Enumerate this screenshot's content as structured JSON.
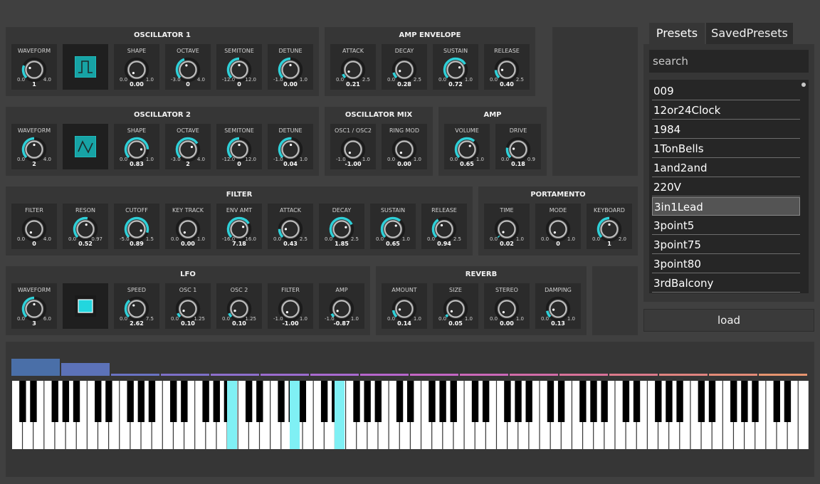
{
  "oscillator1": {
    "title": "OSCILLATOR 1",
    "waveform_icon": "square-wave-icon",
    "knobs": [
      {
        "label": "WAVEFORM",
        "min": "0.0",
        "max": "4.0",
        "value": "1",
        "frac": 0.25
      },
      {
        "label": "SHAPE",
        "min": "0.0",
        "max": "1.0",
        "value": "0.00",
        "frac": 0.0
      },
      {
        "label": "OCTAVE",
        "min": "-3.0",
        "max": "4.0",
        "value": "0",
        "frac": 0.43
      },
      {
        "label": "SEMITONE",
        "min": "-12.0",
        "max": "12.0",
        "value": "0",
        "frac": 0.5
      },
      {
        "label": "DETUNE",
        "min": "-1.0",
        "max": "1.0",
        "value": "0.00",
        "frac": 0.5
      }
    ]
  },
  "amp_envelope": {
    "title": "AMP ENVELOPE",
    "knobs": [
      {
        "label": "ATTACK",
        "min": "0.0",
        "max": "2.5",
        "value": "0.21",
        "frac": 0.08
      },
      {
        "label": "DECAY",
        "min": "0.0",
        "max": "2.5",
        "value": "0.28",
        "frac": 0.11
      },
      {
        "label": "SUSTAIN",
        "min": "0.0",
        "max": "1.0",
        "value": "0.72",
        "frac": 0.72
      },
      {
        "label": "RELEASE",
        "min": "0.0",
        "max": "2.5",
        "value": "0.40",
        "frac": 0.16
      }
    ]
  },
  "oscillator2": {
    "title": "OSCILLATOR 2",
    "waveform_icon": "triangle-wave-icon",
    "knobs": [
      {
        "label": "WAVEFORM",
        "min": "0.0",
        "max": "4.0",
        "value": "2",
        "frac": 0.5
      },
      {
        "label": "SHAPE",
        "min": "0.0",
        "max": "1.0",
        "value": "0.83",
        "frac": 0.83
      },
      {
        "label": "OCTAVE",
        "min": "-3.0",
        "max": "4.0",
        "value": "2",
        "frac": 0.71
      },
      {
        "label": "SEMITONE",
        "min": "-12.0",
        "max": "12.0",
        "value": "0",
        "frac": 0.5
      },
      {
        "label": "DETUNE",
        "min": "-1.0",
        "max": "1.0",
        "value": "0.04",
        "frac": 0.52
      }
    ]
  },
  "oscillator_mix": {
    "title": "OSCILLATOR MIX",
    "knobs": [
      {
        "label": "OSC1 / OSC2",
        "min": "-1.0",
        "max": "1.0",
        "value": "-1.00",
        "frac": 0.0
      },
      {
        "label": "RING MOD",
        "min": "0.0",
        "max": "1.0",
        "value": "0.00",
        "frac": 0.0
      }
    ]
  },
  "amp": {
    "title": "AMP",
    "knobs": [
      {
        "label": "VOLUME",
        "min": "0.0",
        "max": "1.0",
        "value": "0.65",
        "frac": 0.65
      },
      {
        "label": "DRIVE",
        "min": "0.0",
        "max": "0.9",
        "value": "0.18",
        "frac": 0.2
      }
    ]
  },
  "filter": {
    "title": "FILTER",
    "knobs": [
      {
        "label": "FILTER",
        "min": "0.0",
        "max": "4.0",
        "value": "0",
        "frac": 0.0
      },
      {
        "label": "RESON",
        "min": "0.0",
        "max": "0.97",
        "value": "0.52",
        "frac": 0.54
      },
      {
        "label": "CUTOFF",
        "min": "-5.0",
        "max": "1.5",
        "value": "0.89",
        "frac": 0.9
      },
      {
        "label": "KEY TRACK",
        "min": "0.0",
        "max": "1.0",
        "value": "0.00",
        "frac": 0.0
      },
      {
        "label": "ENV AMT",
        "min": "-16.0",
        "max": "16.0",
        "value": "7.18",
        "frac": 0.72
      },
      {
        "label": "ATTACK",
        "min": "0.0",
        "max": "2.5",
        "value": "0.43",
        "frac": 0.17
      },
      {
        "label": "DECAY",
        "min": "0.0",
        "max": "2.5",
        "value": "1.85",
        "frac": 0.74
      },
      {
        "label": "SUSTAIN",
        "min": "0.0",
        "max": "1.0",
        "value": "0.65",
        "frac": 0.65
      },
      {
        "label": "RELEASE",
        "min": "0.0",
        "max": "2.5",
        "value": "0.94",
        "frac": 0.38
      }
    ]
  },
  "portamento": {
    "title": "PORTAMENTO",
    "knobs": [
      {
        "label": "TIME",
        "min": "0.0",
        "max": "1.0",
        "value": "0.02",
        "frac": 0.02
      },
      {
        "label": "MODE",
        "min": "0.0",
        "max": "1.0",
        "value": "0",
        "frac": 0.0
      },
      {
        "label": "KEYBOARD",
        "min": "0.0",
        "max": "2.0",
        "value": "1",
        "frac": 0.5
      }
    ]
  },
  "lfo": {
    "title": "LFO",
    "waveform_icon": "square-block-icon",
    "knobs": [
      {
        "label": "WAVEFORM",
        "min": "0.0",
        "max": "6.0",
        "value": "3",
        "frac": 0.5
      },
      {
        "label": "SPEED",
        "min": "0.0",
        "max": "7.5",
        "value": "2.62",
        "frac": 0.35
      },
      {
        "label": "OSC 1",
        "min": "0.0",
        "max": "1.25",
        "value": "0.10",
        "frac": 0.08
      },
      {
        "label": "OSC 2",
        "min": "0.0",
        "max": "1.25",
        "value": "0.10",
        "frac": 0.08
      },
      {
        "label": "FILTER",
        "min": "-1.0",
        "max": "1.0",
        "value": "-1.00",
        "frac": 0.0
      },
      {
        "label": "AMP",
        "min": "-1.0",
        "max": "1.0",
        "value": "-0.87",
        "frac": 0.07
      }
    ]
  },
  "reverb": {
    "title": "REVERB",
    "knobs": [
      {
        "label": "AMOUNT",
        "min": "0.0",
        "max": "1.0",
        "value": "0.14",
        "frac": 0.14
      },
      {
        "label": "SIZE",
        "min": "0.0",
        "max": "1.0",
        "value": "0.05",
        "frac": 0.05
      },
      {
        "label": "STEREO",
        "min": "0.0",
        "max": "1.0",
        "value": "0.00",
        "frac": 0.0
      },
      {
        "label": "DAMPING",
        "min": "0.0",
        "max": "1.0",
        "value": "0.13",
        "frac": 0.13
      }
    ]
  },
  "presets": {
    "tabs": [
      "Presets",
      "SavedPresets"
    ],
    "search_placeholder": "search",
    "items": [
      "009",
      "12or24Clock",
      "1984",
      "1TonBells",
      "1and2and",
      "220V",
      "3in1Lead",
      "3point5",
      "3point75",
      "3point80",
      "3rdBalcony"
    ],
    "selected_index": 6,
    "load_label": "load"
  },
  "keyboard": {
    "pressed_white_keys": [],
    "pressed_black_semitones": [
      37,
      42,
      46
    ]
  },
  "colors": {
    "accent": "#2fd0d8",
    "panel": "#363636",
    "background": "#404040"
  }
}
